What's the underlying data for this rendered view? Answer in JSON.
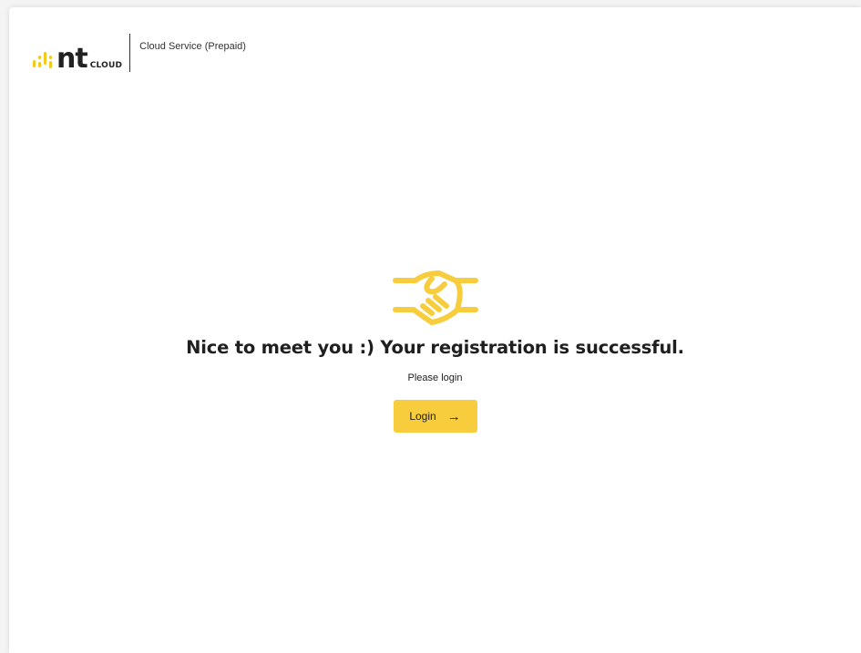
{
  "header": {
    "logo_text": "nt",
    "logo_suffix": "CLOUD",
    "service_label": "Cloud Service (Prepaid)"
  },
  "main": {
    "icon": "handshake-icon",
    "headline": "Nice to meet you :) Your registration is successful.",
    "subtext": "Please login",
    "login_button": {
      "label": "Login",
      "icon": "arrow-right-icon"
    }
  },
  "colors": {
    "accent": "#f7cd3e",
    "text": "#1f1f1f",
    "background": "#ffffff"
  }
}
